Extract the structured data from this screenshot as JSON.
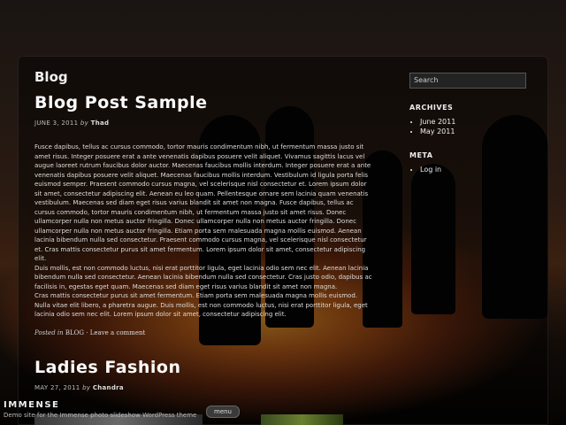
{
  "site": {
    "name": "IMMENSE",
    "tagline": "Demo site for the Immense photo slideshow WordPress theme",
    "menu_label": "menu"
  },
  "main": {
    "blog_title": "Blog",
    "posts": [
      {
        "title": "Blog Post Sample",
        "date": "JUNE 3, 2011",
        "by": "by",
        "author": "Thad",
        "paragraphs": [
          "Fusce dapibus, tellus ac cursus commodo, tortor mauris condimentum nibh, ut fermentum massa justo sit amet risus. Integer posuere erat a ante venenatis dapibus posuere velit aliquet. Vivamus sagittis lacus vel augue laoreet rutrum faucibus dolor auctor. Maecenas faucibus mollis interdum. Integer posuere erat a ante venenatis dapibus posuere velit aliquet. Maecenas faucibus mollis interdum. Vestibulum id ligula porta felis euismod semper. Praesent commodo cursus magna, vel scelerisque nisl consectetur et. Lorem ipsum dolor sit amet, consectetur adipiscing elit. Aenean eu leo quam. Pellentesque ornare sem lacinia quam venenatis vestibulum. Maecenas sed diam eget risus varius blandit sit amet non magna. Fusce dapibus, tellus ac cursus commodo, tortor mauris condimentum nibh, ut fermentum massa justo sit amet risus. Donec ullamcorper nulla non metus auctor fringilla. Donec ullamcorper nulla non metus auctor fringilla. Donec ullamcorper nulla non metus auctor fringilla. Etiam porta sem malesuada magna mollis euismod. Aenean lacinia bibendum nulla sed consectetur. Praesent commodo cursus magna, vel scelerisque nisl consectetur et. Cras mattis consectetur purus sit amet fermentum. Lorem ipsum dolor sit amet, consectetur adipiscing elit.",
          "Duis mollis, est non commodo luctus, nisi erat porttitor ligula, eget lacinia odio sem nec elit. Aenean lacinia bibendum nulla sed consectetur. Aenean lacinia bibendum nulla sed consectetur. Cras justo odio, dapibus ac facilisis in, egestas eget quam. Maecenas sed diam eget risus varius blandit sit amet non magna.",
          "Cras mattis consectetur purus sit amet fermentum. Etiam porta sem malesuada magna mollis euismod. Nulla vitae elit libero, a pharetra augue. Duis mollis, est non commodo luctus, nisi erat porttitor ligula, eget lacinia odio sem nec elit. Lorem ipsum dolor sit amet, consectetur adipiscing elit."
        ],
        "posted_in_label": "Posted in",
        "category": "BLOG",
        "separator": "·",
        "comment_link": "Leave a comment"
      },
      {
        "title": "Ladies Fashion",
        "date": "MAY 27, 2011",
        "by": "by",
        "author": "Chandra"
      }
    ]
  },
  "sidebar": {
    "search_placeholder": "Search",
    "archives_title": "ARCHIVES",
    "archives": [
      "June 2011",
      "May 2011"
    ],
    "meta_title": "META",
    "meta_items": [
      "Log in"
    ]
  },
  "colors": {
    "sunset_glow": "#f0a030",
    "panel_overlay": "#000000",
    "text": "#e8e8e8"
  }
}
